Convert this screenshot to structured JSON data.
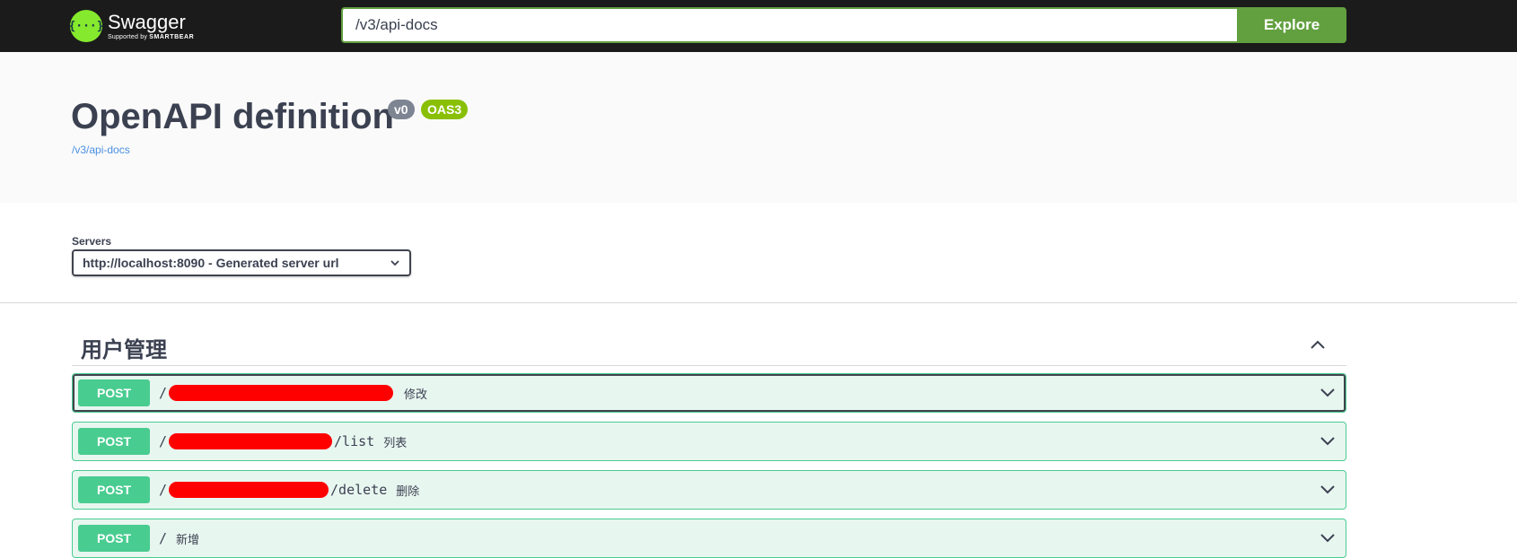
{
  "topbar": {
    "logo_title": "Swagger",
    "logo_sub_prefix": "Supported by ",
    "logo_sub_brand": "SMARTBEAR",
    "logo_glyph": "{···}",
    "url_value": "/v3/api-docs",
    "explore_label": "Explore"
  },
  "info": {
    "title": "OpenAPI definition",
    "version_badge": "v0",
    "oas_badge": "OAS3",
    "link": "/v3/api-docs"
  },
  "servers": {
    "label": "Servers",
    "selected": "http://localhost:8090 - Generated server url"
  },
  "tag": {
    "name": "用户管理"
  },
  "operations": [
    {
      "method": "POST",
      "path_prefix": "/",
      "path_suffix": "",
      "summary": "修改",
      "focused": true
    },
    {
      "method": "POST",
      "path_prefix": "/",
      "path_suffix": "/list",
      "summary": "列表",
      "focused": false
    },
    {
      "method": "POST",
      "path_prefix": "/",
      "path_suffix": "/delete",
      "summary": "删除",
      "focused": false
    },
    {
      "method": "POST",
      "path_prefix": "/",
      "path_suffix": "",
      "summary": "新增",
      "focused": false
    }
  ],
  "colors": {
    "topbar_bg": "#1b1b1b",
    "accent_green": "#62a03f",
    "post_green": "#49cc90",
    "post_bg": "#e8f6f0",
    "redaction": "#ff0000"
  },
  "icons": [
    "swagger-logo-icon",
    "chevron-down-icon",
    "chevron-up-icon"
  ]
}
